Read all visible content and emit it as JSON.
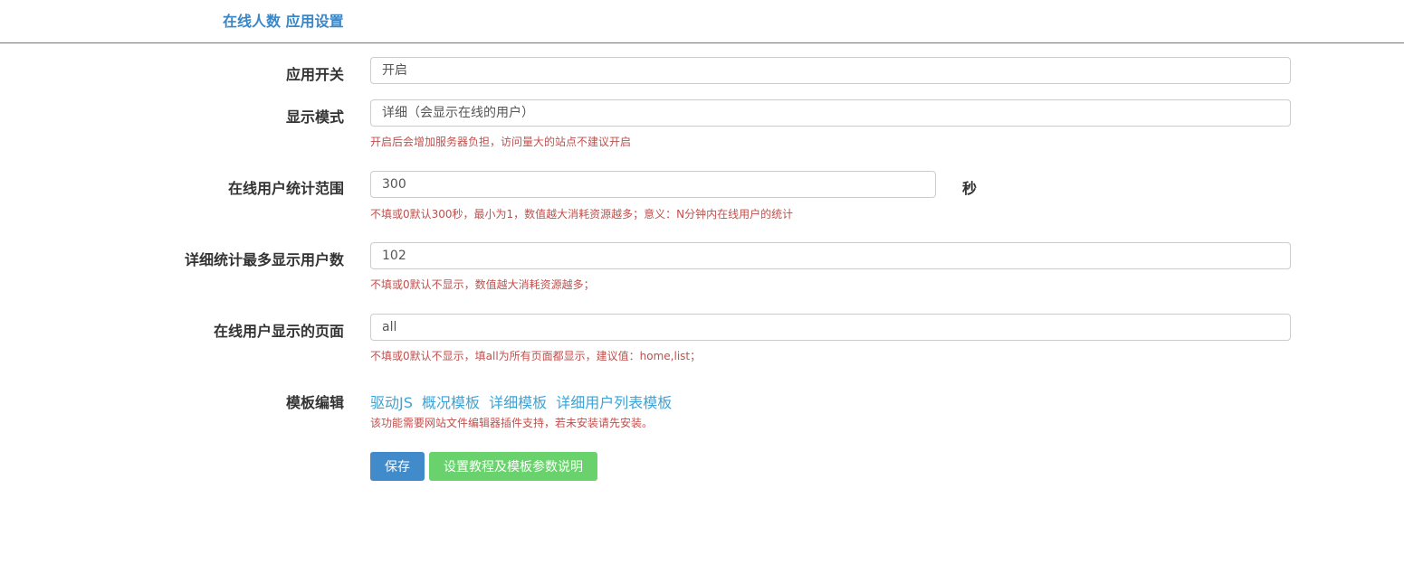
{
  "header": {
    "title": "在线人数 应用设置"
  },
  "fields": {
    "app_switch": {
      "label": "应用开关",
      "value": "开启"
    },
    "display_mode": {
      "label": "显示模式",
      "value": "详细（会显示在线的用户）",
      "hint": "开启后会增加服务器负担，访问量大的站点不建议开启"
    },
    "stat_range": {
      "label": "在线用户统计范围",
      "value": "300",
      "unit": "秒",
      "hint": "不填或0默认300秒，最小为1，数值越大消耗资源越多；意义：N分钟内在线用户的统计"
    },
    "max_users": {
      "label": "详细统计最多显示用户数",
      "value": "102",
      "hint": "不填或0默认不显示，数值越大消耗资源越多；"
    },
    "pages": {
      "label": "在线用户显示的页面",
      "value": "all",
      "hint": "不填或0默认不显示，填all为所有页面都显示，建议值：home,list；"
    }
  },
  "template_edit": {
    "label": "模板编辑",
    "links": [
      "驱动JS",
      "概况模板",
      "详细模板",
      "详细用户列表模板"
    ],
    "hint": "该功能需要网站文件编辑器插件支持，若未安装请先安装。"
  },
  "buttons": {
    "save": "保存",
    "help": "设置教程及模板参数说明"
  },
  "colors": {
    "accent": "#3a87c8",
    "hint": "#c0504d",
    "save": "#428bca",
    "help": "#6ad26d",
    "link": "#3aa4d8"
  }
}
